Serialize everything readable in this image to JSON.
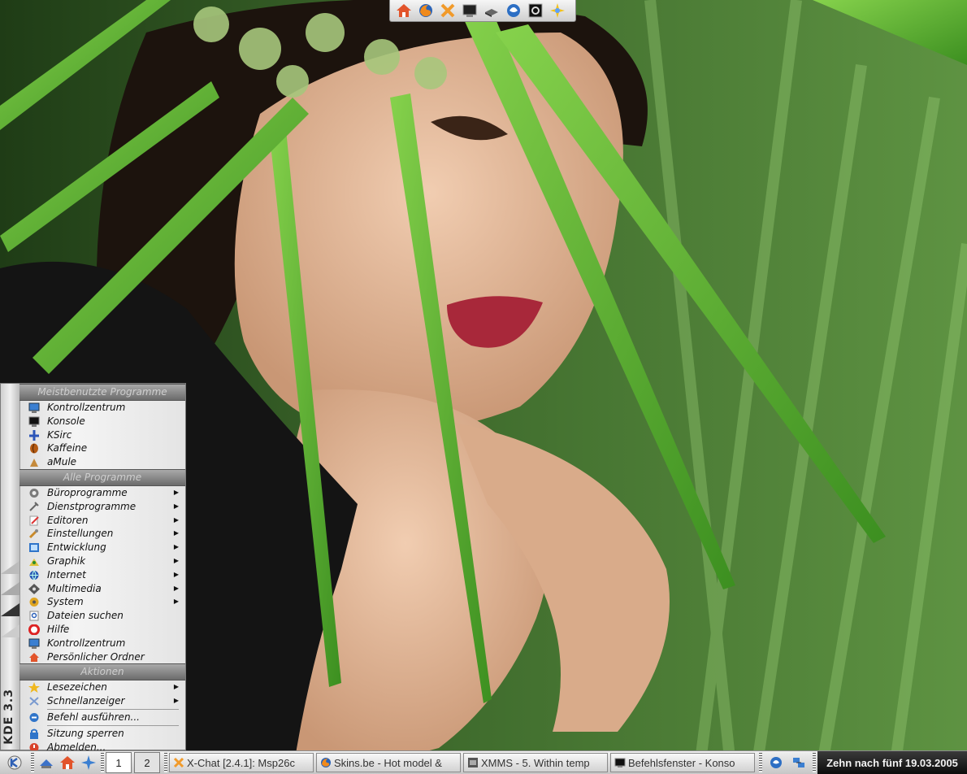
{
  "desktop": {
    "wallpaper": "photo-portrait-with-grass",
    "colors": {
      "menu_header_bg": "#7a7a7a",
      "clock_bg": "#1a1a1a",
      "clock_fg": "#f2f2f2"
    }
  },
  "top_bar": {
    "buttons": [
      {
        "name": "home-icon"
      },
      {
        "name": "firefox-icon"
      },
      {
        "name": "xchat-icon"
      },
      {
        "name": "terminal-icon"
      },
      {
        "name": "drive-icon"
      },
      {
        "name": "kopete-icon"
      },
      {
        "name": "konsole-icon"
      },
      {
        "name": "amarok-icon"
      }
    ]
  },
  "kmenu": {
    "brand": "KDE 3.3",
    "sections": [
      {
        "header": "Meistbenutzte Programme",
        "items": [
          {
            "label": "Kontrollzentrum",
            "icon": "control-center-icon"
          },
          {
            "label": "Konsole",
            "icon": "terminal-icon"
          },
          {
            "label": "KSirc",
            "icon": "ksirc-icon"
          },
          {
            "label": "Kaffeine",
            "icon": "kaffeine-icon"
          },
          {
            "label": "aMule",
            "icon": "amule-icon"
          }
        ]
      },
      {
        "header": "Alle Programme",
        "items": [
          {
            "label": "Büroprogramme",
            "icon": "office-icon",
            "submenu": true
          },
          {
            "label": "Dienstprogramme",
            "icon": "utilities-icon",
            "submenu": true
          },
          {
            "label": "Editoren",
            "icon": "editor-icon",
            "submenu": true
          },
          {
            "label": "Einstellungen",
            "icon": "settings-icon",
            "submenu": true
          },
          {
            "label": "Entwicklung",
            "icon": "development-icon",
            "submenu": true
          },
          {
            "label": "Graphik",
            "icon": "graphics-icon",
            "submenu": true
          },
          {
            "label": "Internet",
            "icon": "internet-icon",
            "submenu": true
          },
          {
            "label": "Multimedia",
            "icon": "multimedia-icon",
            "submenu": true
          },
          {
            "label": "System",
            "icon": "system-icon",
            "submenu": true
          },
          {
            "label": "Dateien suchen",
            "icon": "find-icon"
          },
          {
            "label": "Hilfe",
            "icon": "help-icon"
          },
          {
            "label": "Kontrollzentrum",
            "icon": "control-center-icon"
          },
          {
            "label": "Persönlicher Ordner",
            "icon": "home-icon"
          }
        ]
      },
      {
        "header": "Aktionen",
        "items": [
          {
            "label": "Lesezeichen",
            "icon": "bookmark-icon",
            "submenu": true
          },
          {
            "label": "Schnellanzeiger",
            "icon": "quick-browser-icon",
            "submenu": true
          },
          {
            "label": "Befehl ausführen...",
            "icon": "run-icon"
          },
          {
            "label": "Sitzung sperren",
            "icon": "lock-icon"
          },
          {
            "label": "Abmelden...",
            "icon": "logout-icon"
          }
        ]
      }
    ]
  },
  "taskbar": {
    "desktops": [
      "1",
      "2"
    ],
    "active_desktop": "1",
    "tasks": [
      {
        "label": "X-Chat [2.4.1]: Msp26c",
        "icon": "xchat-icon"
      },
      {
        "label": "Skins.be - Hot model &",
        "icon": "firefox-icon"
      },
      {
        "label": "XMMS - 5. Within temp",
        "icon": "xmms-icon"
      },
      {
        "label": "Befehlsfenster - Konso",
        "icon": "terminal-icon"
      }
    ],
    "clock": "Zehn nach fünf 19.03.2005"
  }
}
